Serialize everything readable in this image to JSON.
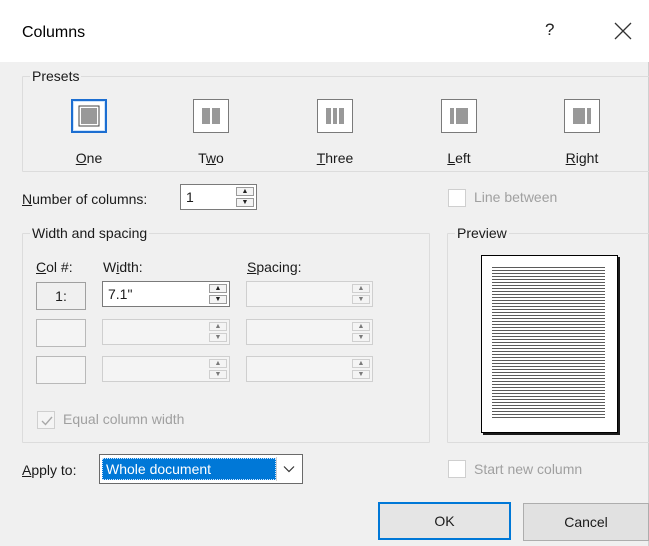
{
  "window": {
    "title": "Columns",
    "help_label": "?"
  },
  "presets": {
    "legend": "Presets",
    "items": [
      {
        "label_u": "O",
        "label_rest": "ne",
        "icon": "one-column-icon",
        "selected": true
      },
      {
        "label_pre": "T",
        "label_u": "w",
        "label_rest": "o",
        "icon": "two-columns-icon"
      },
      {
        "label_u": "T",
        "label_rest": "hree",
        "icon": "three-columns-icon"
      },
      {
        "label_u": "L",
        "label_rest": "eft",
        "icon": "left-columns-icon"
      },
      {
        "label_u": "R",
        "label_rest": "ight",
        "icon": "right-columns-icon"
      }
    ]
  },
  "number_of_columns": {
    "label_u": "N",
    "label_rest": "umber of columns:",
    "value": "1"
  },
  "line_between": {
    "label": "Line between",
    "checked": false,
    "enabled": false
  },
  "width_spacing": {
    "legend": "Width and spacing",
    "col_header_u": "C",
    "col_header_rest": "ol #:",
    "width_header_pre": "W",
    "width_header_u": "i",
    "width_header_rest": "dth:",
    "spacing_header_u": "S",
    "spacing_header_rest": "pacing:",
    "rows": [
      {
        "col": "1:",
        "width": "7.1\"",
        "spacing": ""
      },
      {
        "col": "",
        "width": "",
        "spacing": ""
      },
      {
        "col": "",
        "width": "",
        "spacing": ""
      }
    ],
    "equal_width_label": "Equal column width",
    "equal_width_checked": true
  },
  "preview": {
    "legend": "Preview"
  },
  "apply_to": {
    "label_u": "A",
    "label_rest": "pply to:",
    "selected": "Whole document"
  },
  "start_new_column": {
    "label": "Start new column",
    "checked": false,
    "enabled": false
  },
  "buttons": {
    "ok": "OK",
    "cancel": "Cancel"
  },
  "colors": {
    "accent": "#0078d7",
    "dialog_bg": "#f0f0f0"
  }
}
